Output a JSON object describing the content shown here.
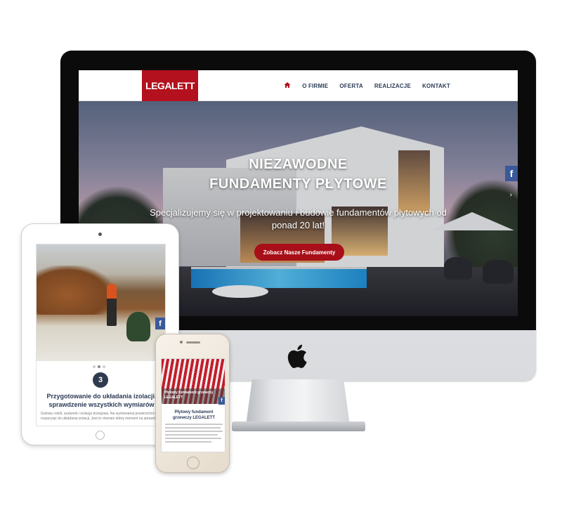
{
  "desktop": {
    "logo_text": "LEGALETT",
    "nav": {
      "home_icon": "home-icon",
      "items": [
        "O FIRMIE",
        "OFERTA",
        "REALIZACJE",
        "KONTAKT"
      ]
    },
    "hero": {
      "title_line1": "NIEZAWODNE",
      "title_line2": "FUNDAMENTY PŁYTOWE",
      "subtitle_line1": "Specjalizujemy się w projektowaniu i budowie fundamentów płytowych od",
      "subtitle_line2": "ponad 20 lat!",
      "cta_label": "Zobacz Nasze Fundamenty"
    },
    "facebook_label": "f",
    "slider_arrow": "›"
  },
  "tablet": {
    "facebook_label": "f",
    "step_number": "3",
    "title_line1": "Przygotowanie do układania izolacji,",
    "title_line2": "sprawdzenie wszystkich wymiarów",
    "body_line1": "Gotowy cokół, szalunek i izolacja brzegowa. Na wyrównanej powierzchni można",
    "body_line2": "rozpocząć do układania izolacji. Jest to również dobry moment na sprawdzenie"
  },
  "phone": {
    "caption_line1": "Płytowy fundament grzewczy",
    "caption_line2": "LEGALETT",
    "facebook_label": "f",
    "title_line1": "Płytowy fundament",
    "title_line2": "grzewczy LEGALETT"
  },
  "colors": {
    "brand_red": "#b3111d",
    "nav_text": "#2b3a55",
    "facebook": "#3b5998"
  }
}
